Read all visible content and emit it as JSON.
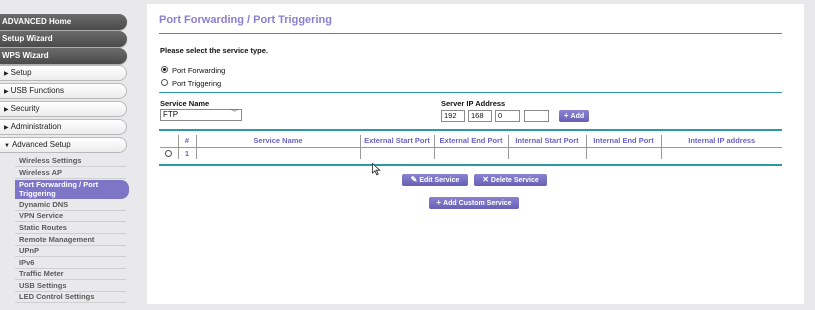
{
  "sidebar": {
    "top_buttons": [
      "ADVANCED Home",
      "Setup Wizard",
      "WPS Wizard"
    ],
    "sections": [
      {
        "label": "Setup"
      },
      {
        "label": "USB Functions"
      },
      {
        "label": "Security"
      },
      {
        "label": "Administration"
      },
      {
        "label": "Advanced Setup"
      }
    ],
    "sub_items": [
      "Wireless Settings",
      "Wireless AP",
      "Port Forwarding / Port Triggering",
      "Dynamic DNS",
      "VPN Service",
      "Static Routes",
      "Remote Management",
      "UPnP",
      "IPv6",
      "Traffic Meter",
      "USB Settings",
      "LED Control Settings"
    ]
  },
  "main": {
    "title": "Port Forwarding / Port Triggering",
    "service_type_prompt": "Please select the service type.",
    "radio_port_forwarding": "Port Forwarding",
    "radio_port_triggering": "Port Triggering",
    "service_name_label": "Service Name",
    "service_name_value": "FTP",
    "server_ip_label": "Server IP Address",
    "ip_octets": [
      "192",
      "168",
      "0",
      ""
    ],
    "add_button": "Add",
    "table": {
      "headers": [
        "",
        "#",
        "Service Name",
        "External Start Port",
        "External End Port",
        "Internal Start Port",
        "Internal End Port",
        "Internal IP address"
      ],
      "rows": [
        {
          "num": "1",
          "service_name": "",
          "ext_start": "",
          "ext_end": "",
          "int_start": "",
          "int_end": "",
          "int_ip": ""
        }
      ]
    },
    "edit_service_button": "Edit Service",
    "delete_service_button": "Delete Service",
    "add_custom_service_button": "Add Custom Service"
  },
  "colors": {
    "accent_purple": "#7f75c6",
    "rule_teal": "#2b9aa6",
    "sidebar_dark": "#555555"
  }
}
